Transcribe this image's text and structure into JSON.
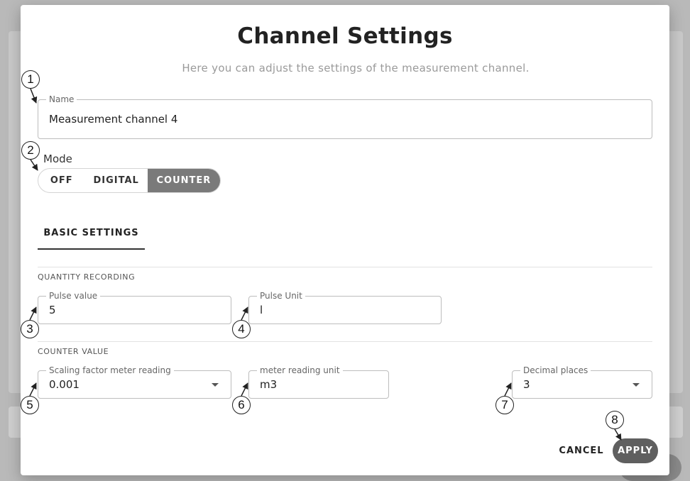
{
  "dialog": {
    "title": "Channel Settings",
    "subtitle": "Here you can adjust the settings of the measurement channel."
  },
  "name_field": {
    "label": "Name",
    "value": "Measurement channel 4"
  },
  "mode": {
    "label": "Mode",
    "options": [
      "OFF",
      "DIGITAL",
      "COUNTER"
    ],
    "selected": "COUNTER"
  },
  "tabs": [
    {
      "label": "BASIC SETTINGS",
      "active": true
    }
  ],
  "quantity_recording": {
    "heading": "QUANTITY RECORDING",
    "pulse_value": {
      "label": "Pulse value",
      "value": "5"
    },
    "pulse_unit": {
      "label": "Pulse Unit",
      "value": "l"
    }
  },
  "counter_value": {
    "heading": "COUNTER VALUE",
    "scaling_factor": {
      "label": "Scaling factor meter reading",
      "value": "0.001"
    },
    "meter_reading_unit": {
      "label": "meter reading unit",
      "value": "m3"
    },
    "decimal_places": {
      "label": "Decimal places",
      "value": "3"
    }
  },
  "actions": {
    "cancel_label": "CANCEL",
    "apply_label": "APPLY"
  },
  "markers": [
    "1",
    "2",
    "3",
    "4",
    "5",
    "6",
    "7",
    "8"
  ],
  "icons": {
    "dropdown": "chevron-down-icon"
  },
  "colors": {
    "toggle_active": "#7a7a7a",
    "apply_button": "#5f5f5f",
    "muted_text": "#9a9a9a"
  }
}
